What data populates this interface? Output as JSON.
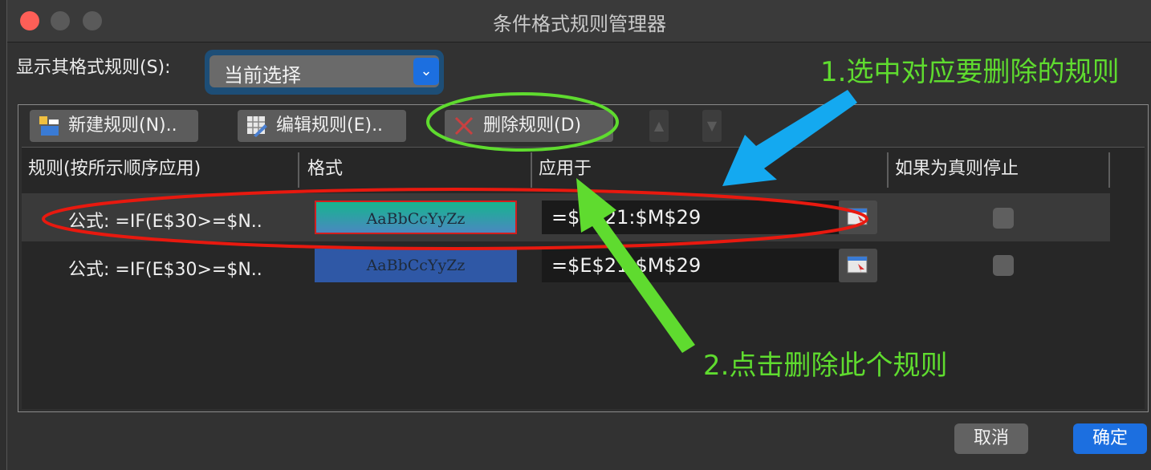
{
  "window": {
    "title": "条件格式规则管理器"
  },
  "filter": {
    "label": "显示其格式规则(S):",
    "value": "当前选择"
  },
  "toolbar": {
    "new_rule": "新建规则(N)..",
    "edit_rule": "编辑规则(E)..",
    "delete_rule": "删除规则(D)"
  },
  "table": {
    "headers": [
      "规则(按所示顺序应用)",
      "格式",
      "应用于",
      "如果为真则停止"
    ],
    "rows": [
      {
        "rule": "公式: =IF(E$30>=$N..",
        "preview": "AaBbCcYyZz",
        "applies_to": "=$E$21:$M$29",
        "stop_if_true": false,
        "selected": true
      },
      {
        "rule": "公式: =IF(E$30>=$N..",
        "preview": "AaBbCcYyZz",
        "applies_to": "=$E$21:$M$29",
        "stop_if_true": false,
        "selected": false
      }
    ]
  },
  "footer": {
    "cancel": "取消",
    "ok": "确定"
  },
  "annotations": {
    "step1": "1.选中对应要删除的规则",
    "step2": "2.点击删除此个规则"
  },
  "colors": {
    "accent_blue": "#1c6fe0",
    "annotation_green": "#5fdb2f",
    "annotation_red": "#e8190f",
    "annotation_cyan": "#14a9f0"
  },
  "icons": {
    "new_rule": "new-rule-icon",
    "edit_rule": "edit-rule-icon",
    "delete_rule": "delete-x-icon",
    "range_select": "range-select-icon",
    "dropdown": "chevron-down-icon"
  }
}
